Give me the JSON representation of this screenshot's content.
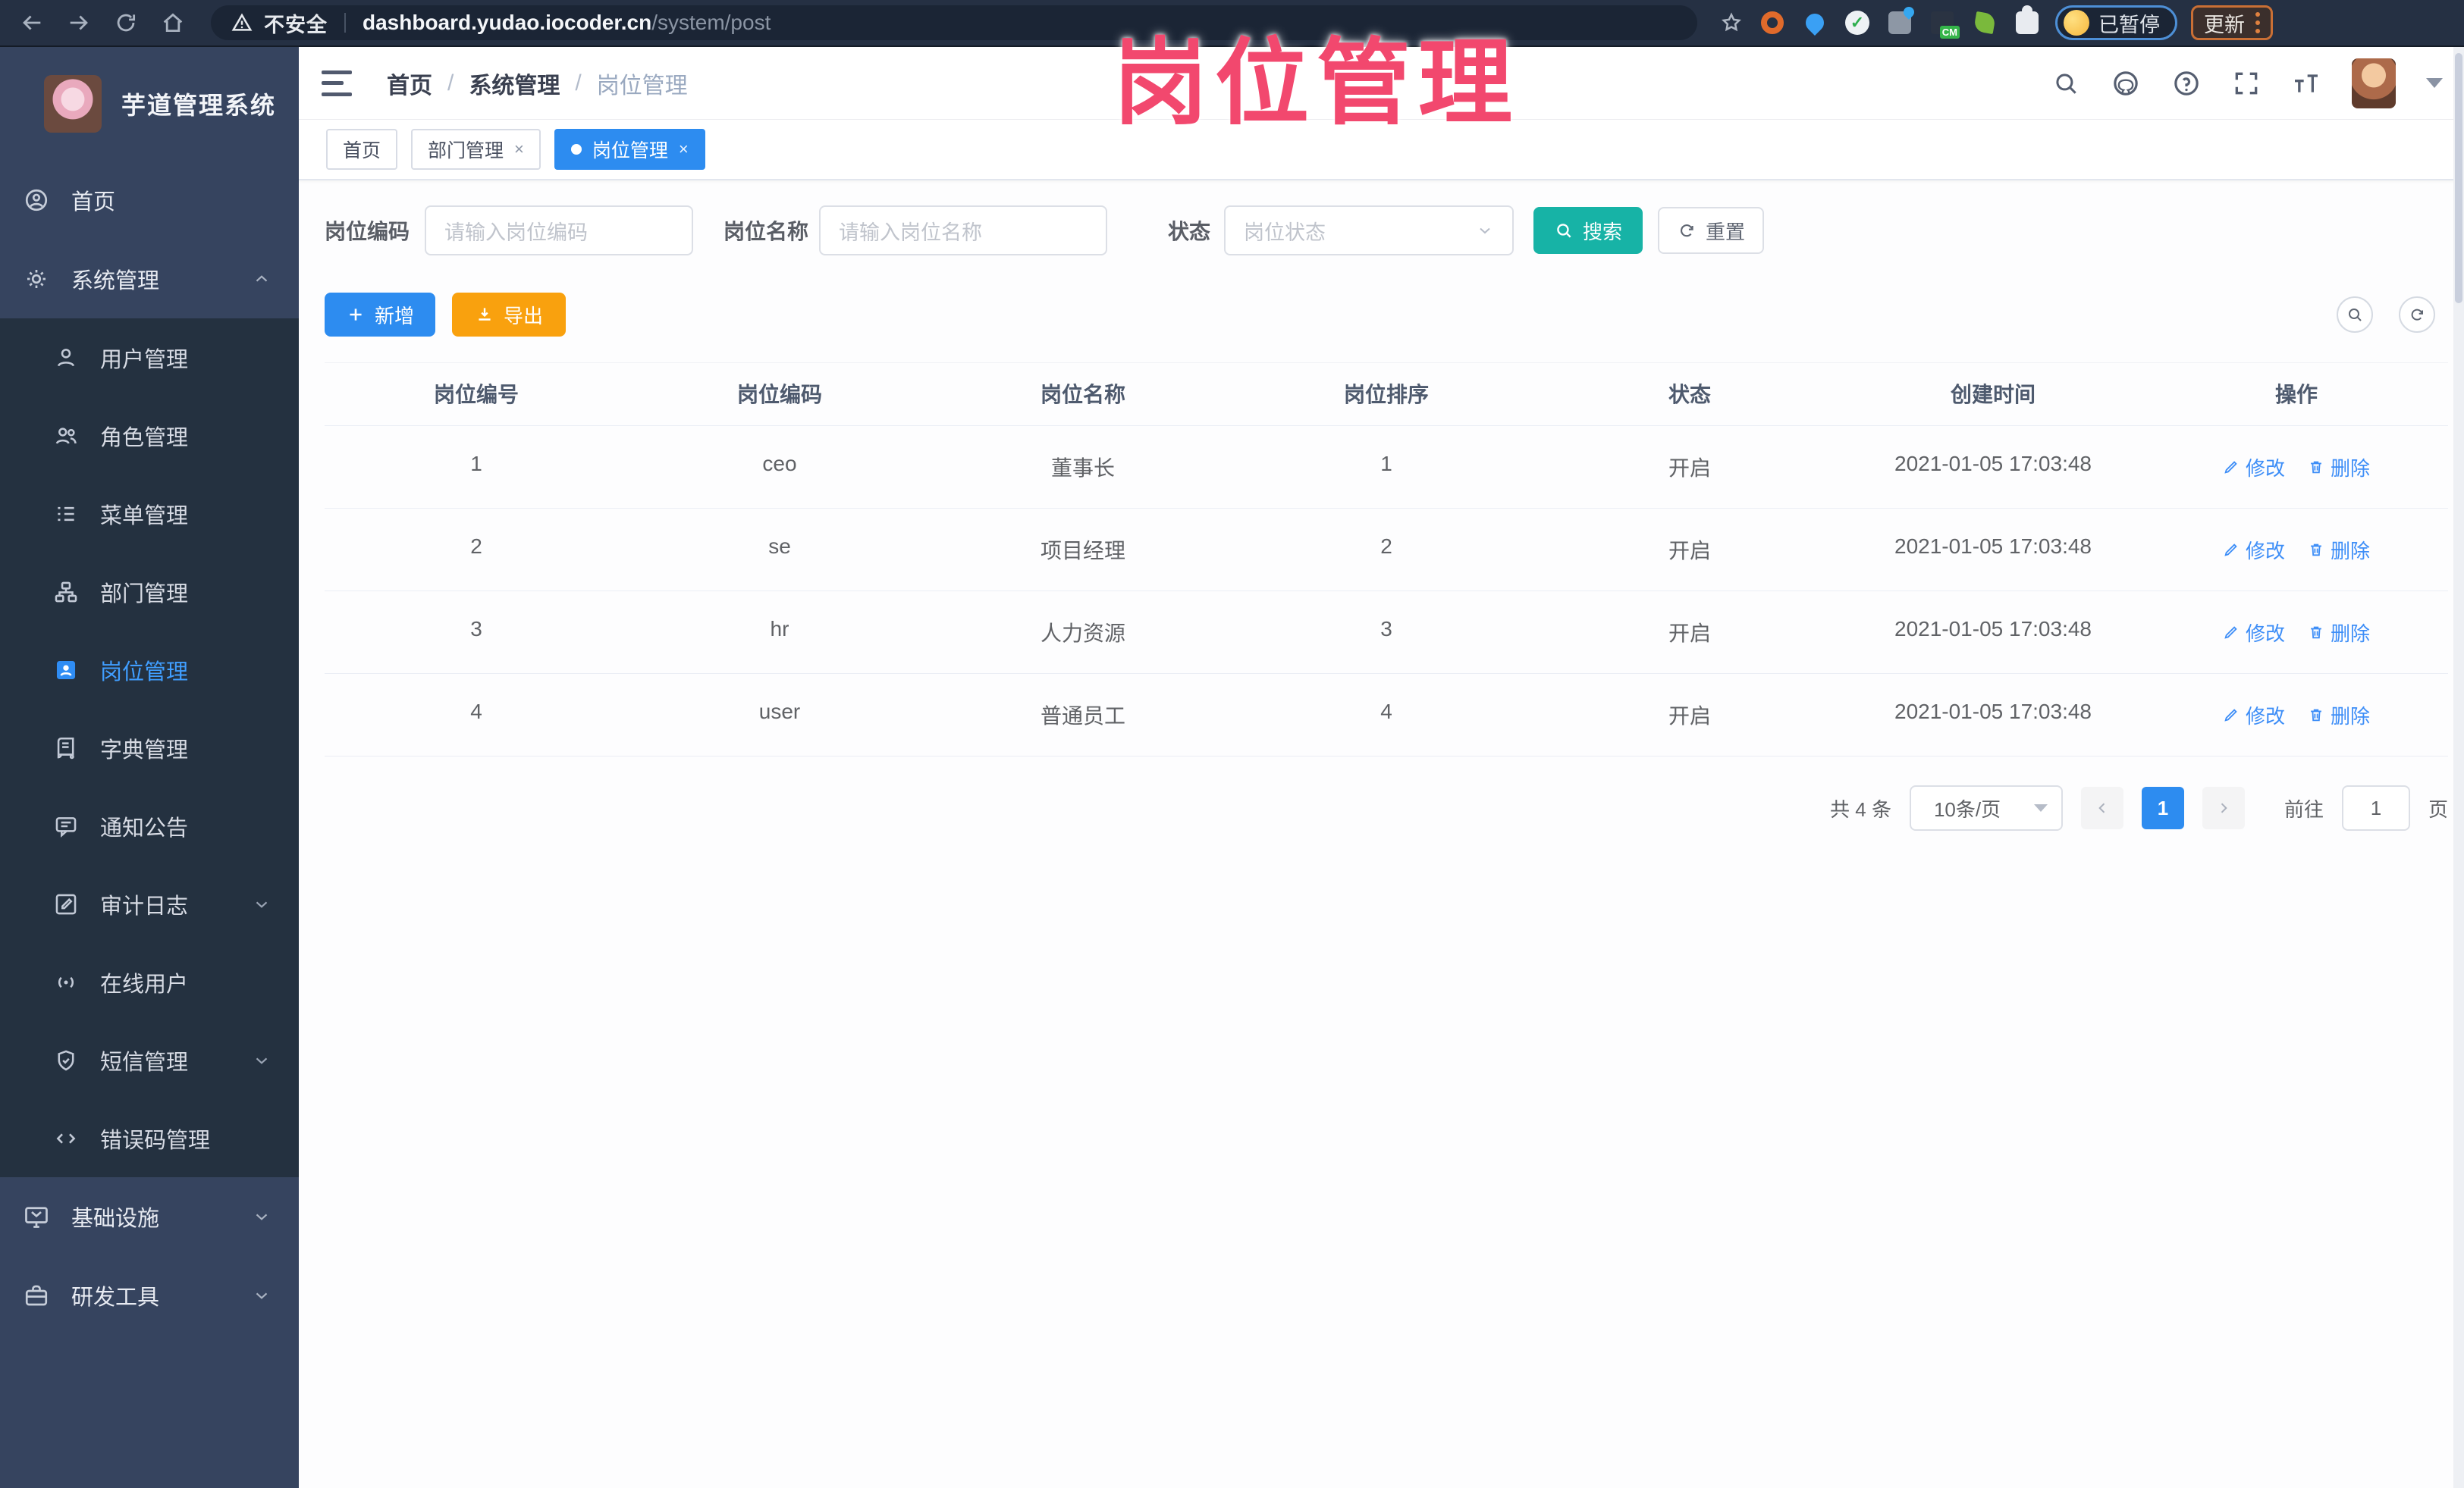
{
  "chrome": {
    "security_label": "不安全",
    "url_domain": "dashboard.yudao.iocoder.cn",
    "url_path": "/system/post",
    "paused_label": "已暂停",
    "update_label": "更新"
  },
  "annotation": {
    "text": "岗位管理",
    "color": "#f2486e"
  },
  "sidebar": {
    "title": "芋道管理系统",
    "items": [
      {
        "label": "首页"
      },
      {
        "label": "系统管理"
      },
      {
        "label": "基础设施"
      },
      {
        "label": "研发工具"
      }
    ],
    "submenu": [
      "用户管理",
      "角色管理",
      "菜单管理",
      "部门管理",
      "岗位管理",
      "字典管理",
      "通知公告",
      "审计日志",
      "在线用户",
      "短信管理",
      "错误码管理"
    ]
  },
  "header": {
    "breadcrumb": [
      "首页",
      "系统管理",
      "岗位管理"
    ],
    "sep": "/"
  },
  "tabs": [
    {
      "label": "首页"
    },
    {
      "label": "部门管理",
      "close": "×"
    },
    {
      "label": "岗位管理",
      "close": "×"
    }
  ],
  "filters": {
    "code_label": "岗位编码",
    "code_placeholder": "请输入岗位编码",
    "name_label": "岗位名称",
    "name_placeholder": "请输入岗位名称",
    "status_label": "状态",
    "status_placeholder": "岗位状态",
    "search_label": "搜索",
    "reset_label": "重置"
  },
  "toolbar": {
    "add_label": "新增",
    "export_label": "导出"
  },
  "table": {
    "columns": [
      "岗位编号",
      "岗位编码",
      "岗位名称",
      "岗位排序",
      "状态",
      "创建时间",
      "操作"
    ],
    "rows": [
      [
        "1",
        "ceo",
        "董事长",
        "1",
        "开启",
        "2021-01-05 17:03:48"
      ],
      [
        "2",
        "se",
        "项目经理",
        "2",
        "开启",
        "2021-01-05 17:03:48"
      ],
      [
        "3",
        "hr",
        "人力资源",
        "3",
        "开启",
        "2021-01-05 17:03:48"
      ],
      [
        "4",
        "user",
        "普通员工",
        "4",
        "开启",
        "2021-01-05 17:03:48"
      ]
    ],
    "edit_label": "修改",
    "delete_label": "删除"
  },
  "pagination": {
    "total": "共 4 条",
    "page_size": "10条/页",
    "current": "1",
    "goto_prefix": "前往",
    "goto_value": "1",
    "goto_suffix": "页"
  },
  "colors": {
    "primary": "#2d8cf0",
    "teal": "#17b3a6",
    "warning": "#f9a10e",
    "link": "#3e8ef7",
    "active_menu": "#409eff",
    "annotation": "#f2486e",
    "sidebar": "#36445f",
    "submenu": "#243140",
    "chrome": "#253043"
  }
}
